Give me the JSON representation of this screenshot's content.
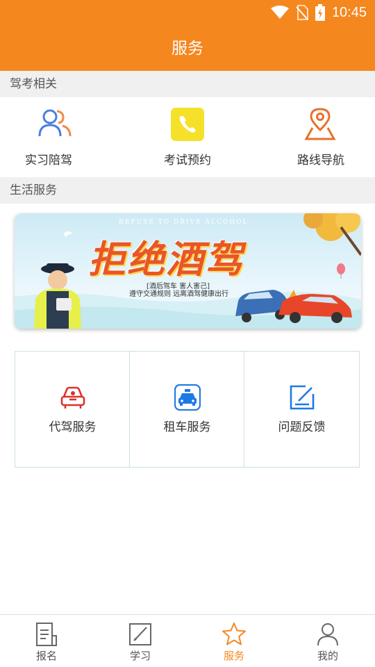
{
  "status_bar": {
    "time": "10:45",
    "icons": [
      "wifi-icon",
      "no-sim-icon",
      "battery-charging-icon"
    ]
  },
  "header": {
    "title": "服务"
  },
  "sections": {
    "exam": "驾考相关",
    "life": "生活服务"
  },
  "exam_items": [
    {
      "label": "实习陪驾",
      "icon": "people-icon"
    },
    {
      "label": "考试预约",
      "icon": "phone-icon"
    },
    {
      "label": "路线导航",
      "icon": "map-pin-icon"
    }
  ],
  "banner": {
    "refuse_text": "REFUSE TO DRIVE ALCOHOL",
    "title": "拒绝酒驾",
    "sub1": "[酒后驾车 害人害己]",
    "sub2": "遵守交通规则 远离酒驾健康出行"
  },
  "services": [
    {
      "label": "代驾服务",
      "icon": "designated-driver-icon"
    },
    {
      "label": "租车服务",
      "icon": "car-rental-icon"
    },
    {
      "label": "问题反馈",
      "icon": "feedback-icon"
    }
  ],
  "bottom_nav": [
    {
      "label": "报名",
      "icon": "register-icon",
      "active": false
    },
    {
      "label": "学习",
      "icon": "study-icon",
      "active": false
    },
    {
      "label": "服务",
      "icon": "star-icon",
      "active": true
    },
    {
      "label": "我的",
      "icon": "profile-icon",
      "active": false
    }
  ],
  "colors": {
    "brand": "#f5871f",
    "section_bg": "#f0f0f0",
    "blue": "#1e78e6",
    "red": "#d9332b",
    "yellow": "#f5e12a"
  }
}
